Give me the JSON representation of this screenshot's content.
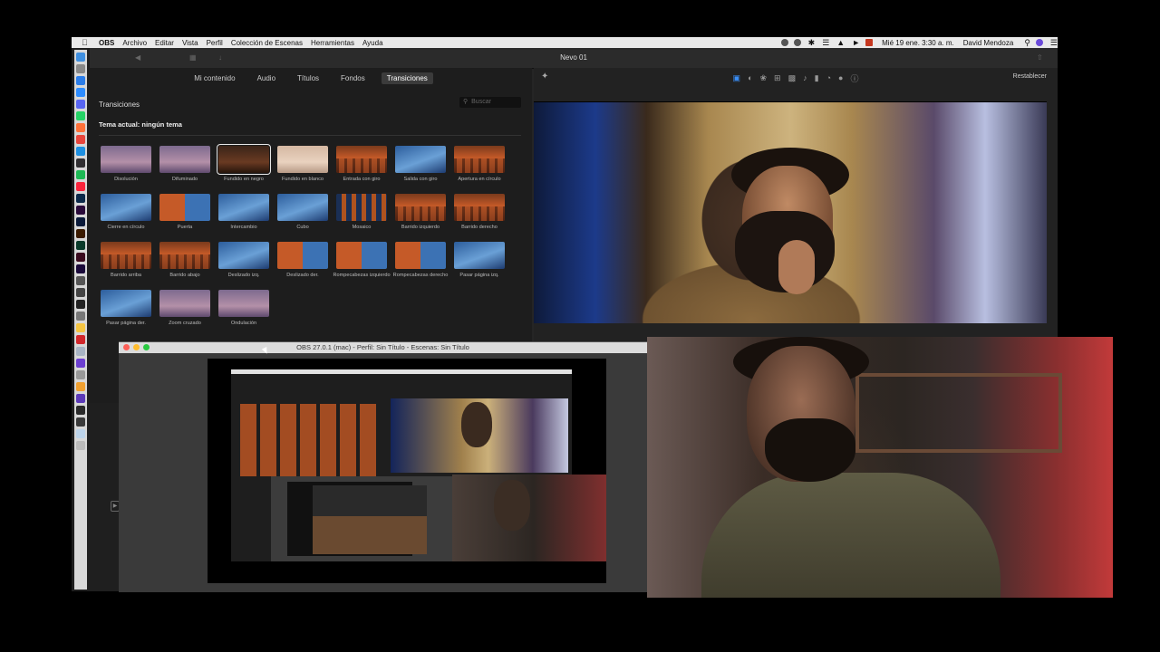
{
  "menubar": {
    "app_name": "OBS",
    "items": [
      "Archivo",
      "Editar",
      "Vista",
      "Perfil",
      "Colección de Escenas",
      "Herramientas",
      "Ayuda"
    ],
    "clock": "Mié 19 ene.  3:30 a. m.",
    "user": "David Mendoza"
  },
  "imovie": {
    "project_title": "Nevo 01",
    "tabs": [
      {
        "label": "Mi contenido"
      },
      {
        "label": "Audio"
      },
      {
        "label": "Títulos"
      },
      {
        "label": "Fondos"
      },
      {
        "label": "Transiciones"
      }
    ],
    "active_tab": "Transiciones",
    "section_title": "Transiciones",
    "search_placeholder": "Buscar",
    "current_theme": "Tema actual: ningún tema",
    "transitions": [
      {
        "label": "Disolución",
        "style": "t-purple"
      },
      {
        "label": "Difuminado",
        "style": "t-purple"
      },
      {
        "label": "Fundido en negro",
        "style": "t-dark"
      },
      {
        "label": "Fundido en blanco",
        "style": "t-light"
      },
      {
        "label": "Entrada con giro",
        "style": "t-forest"
      },
      {
        "label": "Salida con giro",
        "style": "t-blue"
      },
      {
        "label": "Apertura en círculo",
        "style": "t-forest"
      },
      {
        "label": "Cierre en círculo",
        "style": "t-blue"
      },
      {
        "label": "Puerta",
        "style": "t-half"
      },
      {
        "label": "Intercambio",
        "style": "t-blue"
      },
      {
        "label": "Cubo",
        "style": "t-blue"
      },
      {
        "label": "Mosaico",
        "style": "t-mosaic"
      },
      {
        "label": "Barrido izquierdo",
        "style": "t-forest"
      },
      {
        "label": "Barrido derecho",
        "style": "t-forest"
      },
      {
        "label": "Barrido arriba",
        "style": "t-forest"
      },
      {
        "label": "Barrido abajo",
        "style": "t-forest"
      },
      {
        "label": "Deslizado izq.",
        "style": "t-blue"
      },
      {
        "label": "Deslizado der.",
        "style": "t-half"
      },
      {
        "label": "Rompecabezas izquierdo",
        "style": "t-half"
      },
      {
        "label": "Rompecabezas derecho",
        "style": "t-half"
      },
      {
        "label": "Pasar página izq.",
        "style": "t-blue"
      },
      {
        "label": "Pasar página der.",
        "style": "t-blue"
      },
      {
        "label": "Zoom cruzado",
        "style": "t-purple"
      },
      {
        "label": "Ondulación",
        "style": "t-purple"
      }
    ],
    "selected_transition_index": 2,
    "reset_label": "Restablecer"
  },
  "obs": {
    "window_title": "OBS 27.0.1 (mac) - Perfil: Sin Título - Escenas: Sin Título"
  },
  "colors": {
    "accent": "#3a8ef6",
    "close": "#fd5f57",
    "minimize": "#febc2e",
    "zoom": "#28c840"
  }
}
